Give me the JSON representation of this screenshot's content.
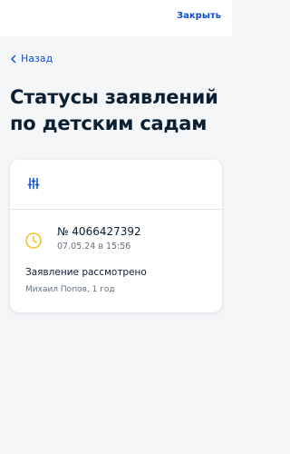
{
  "header": {
    "close_label": "Закрыть"
  },
  "nav": {
    "back_label": "Назад",
    "back_icon": "chevron-left-icon"
  },
  "page": {
    "title": "Статусы заявлений по детским садам"
  },
  "card": {
    "filter_icon": "filter-sliders-icon",
    "application": {
      "status_icon": "clock-icon",
      "number": "№ 4066427392",
      "date": "07.05.24 в 15:56",
      "status": "Заявление рассмотрено",
      "child": "Михаил Попов, 1 год"
    }
  },
  "colors": {
    "accent": "#0d4cd3",
    "clock": "#f2c233",
    "text": "#0b1f33",
    "secondary": "#66727f",
    "background": "#f5f6f8"
  }
}
